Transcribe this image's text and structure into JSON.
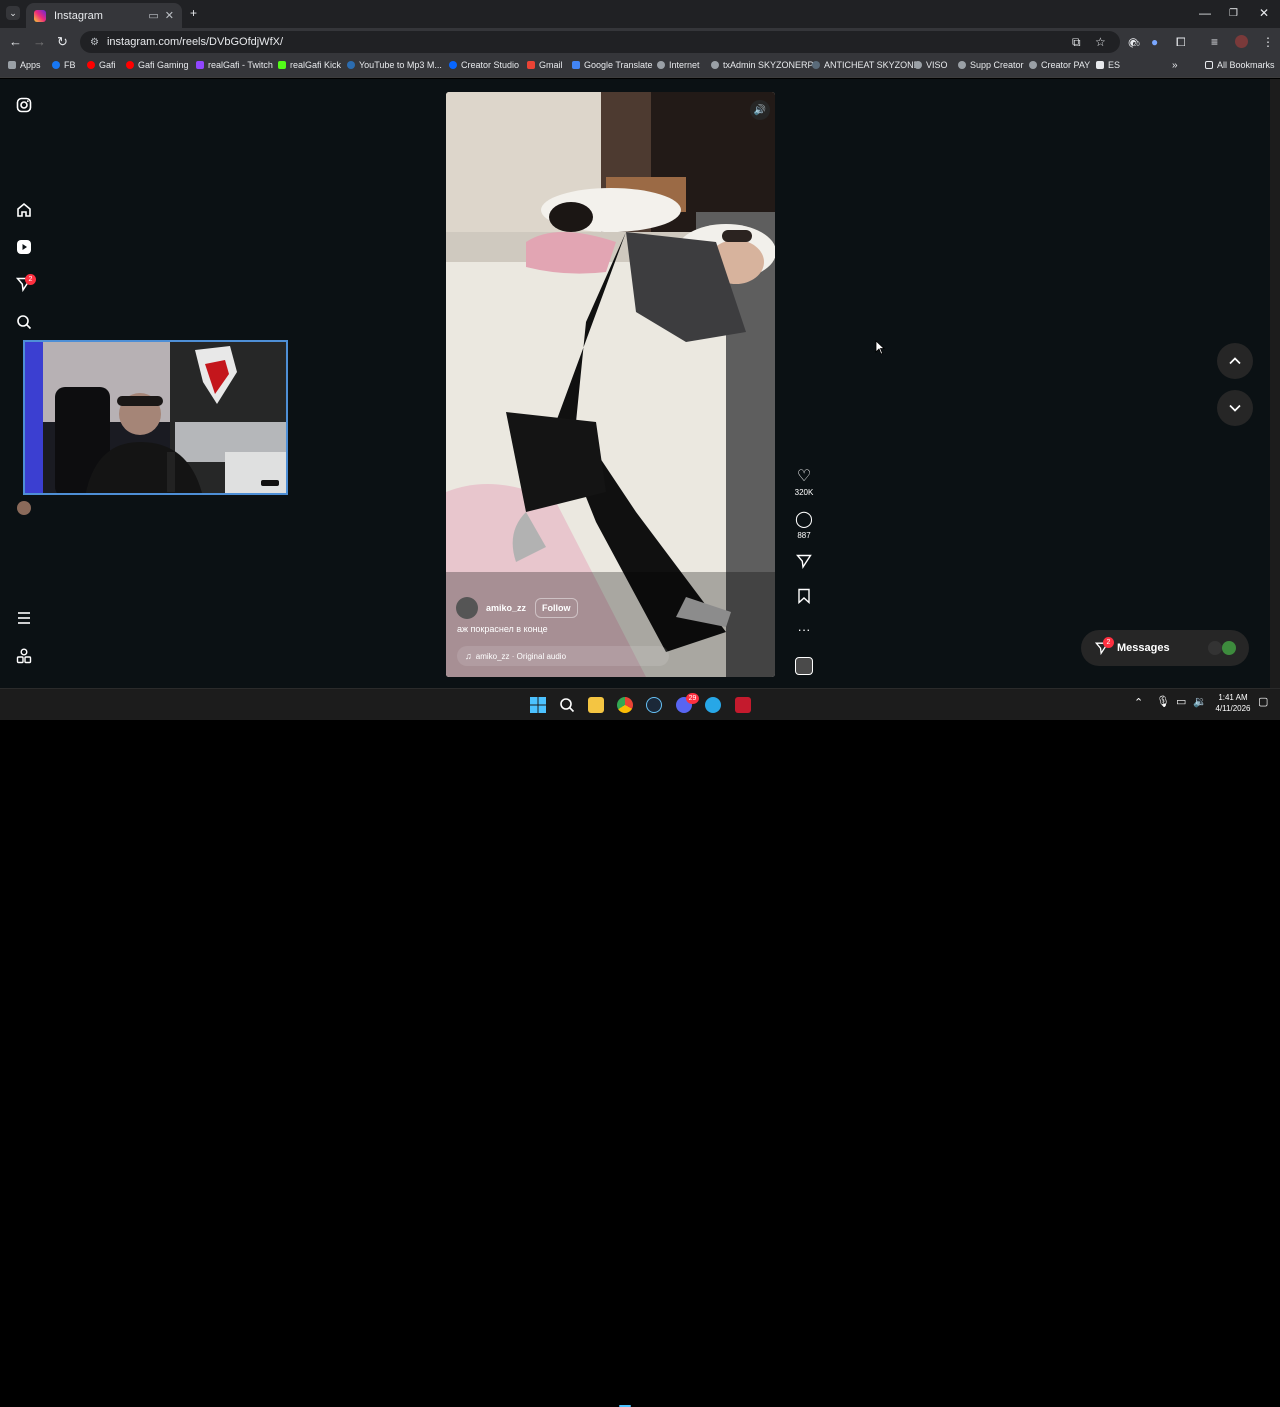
{
  "browser": {
    "tab_title": "Instagram",
    "url": "instagram.com/reels/DVbGOfdjWfX/",
    "extension_badge": "20",
    "bookmarks": [
      "Apps",
      "FB",
      "Gafi",
      "Gafi Gaming",
      "realGafi - Twitch",
      "realGafi Kick",
      "YouTube to Mp3 M...",
      "Creator Studio",
      "Gmail",
      "Google Translate",
      "Internet",
      "txAdmin SKYZONERP",
      "ANTICHEAT SKYZONE",
      "VISO",
      "Supp Creator",
      "Creator PAY",
      "ES"
    ],
    "all_bookmarks": "All Bookmarks"
  },
  "sidebar": {
    "notifications_badge": "2"
  },
  "reel": {
    "username": "amiko_zz",
    "follow_label": "Follow",
    "caption": "аж покраснел в конце",
    "audio": "amiko_zz · Original audio",
    "likes": "320K",
    "comments": "887"
  },
  "messages": {
    "label": "Messages",
    "badge": "2"
  },
  "taskbar": {
    "time": "1:41 AM",
    "date": "4/11/2026",
    "discord_badge": "29"
  },
  "colors": {
    "page_bg": "#0b1114",
    "accent_badge": "#ff3040",
    "webcam_border": "#4e8fd6"
  }
}
